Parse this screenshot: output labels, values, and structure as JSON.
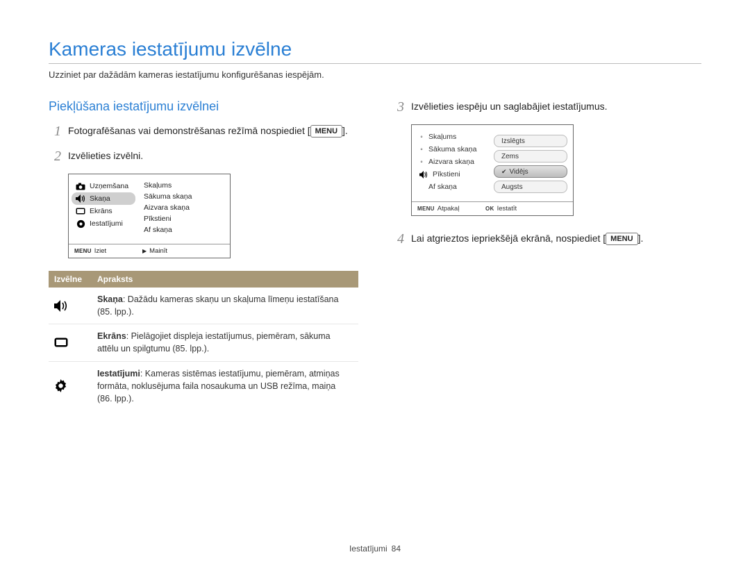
{
  "header": {
    "title": "Kameras iestatījumu izvēlne",
    "subtitle": "Uzziniet par dažādām kameras iestatījumu konfigurēšanas iespējām."
  },
  "left": {
    "section_title": "Piekļūšana iestatījumu izvēlnei",
    "step1_before": "Fotografēšanas vai demonstrēšanas režīmā nospiediet [",
    "step1_menu": "MENU",
    "step1_after": "].",
    "step2": "Izvēlieties izvēlni.",
    "camera_menu": {
      "left_items": [
        "Uzņemšana",
        "Skaņa",
        "Ekrāns",
        "Iestatījumi"
      ],
      "selected_index": 1,
      "right_items": [
        "Skaļums",
        "Sākuma skaņa",
        "Aizvara skaņa",
        "Pīkstieni",
        "Af skaņa"
      ],
      "footer_left_key": "MENU",
      "footer_left_label": "Iziet",
      "footer_right_label": "Mainīt"
    },
    "table": {
      "col1": "Izvēlne",
      "col2": "Apraksts",
      "rows": [
        {
          "icon": "sound",
          "title": "Skaņa",
          "text": ": Dažādu kameras skaņu un skaļuma līmeņu iestatīšana (85. lpp.)."
        },
        {
          "icon": "display",
          "title": "Ekrāns",
          "text": ": Pielāgojiet displeja iestatījumus, piemēram, sākuma attēlu un spilgtumu (85. lpp.)."
        },
        {
          "icon": "settings",
          "title": "Iestatījumi",
          "text": ": Kameras sistēmas iestatījumu, piemēram, atmiņas formāta, noklusējuma faila nosaukuma un USB režīma, maiņa (86. lpp.)."
        }
      ]
    }
  },
  "right": {
    "step3": "Izvēlieties iespēju un saglabājiet iestatījumus.",
    "camera_menu": {
      "left_items": [
        "Skaļums",
        "Sākuma skaņa",
        "Aizvara skaņa",
        "Pīkstieni",
        "Af skaņa"
      ],
      "bullet_index": 0,
      "options": [
        "Izslēgts",
        "Zems",
        "Vidējs",
        "Augsts"
      ],
      "selected_option": 2,
      "footer_left_key": "MENU",
      "footer_left_label": "Atpakaļ",
      "footer_right_key": "OK",
      "footer_right_label": "Iestatīt"
    },
    "step4_before": "Lai atgrieztos iepriekšējā ekrānā, nospiediet [",
    "step4_menu": "MENU",
    "step4_after": "]."
  },
  "footer": {
    "section": "Iestatījumi",
    "page": "84"
  }
}
